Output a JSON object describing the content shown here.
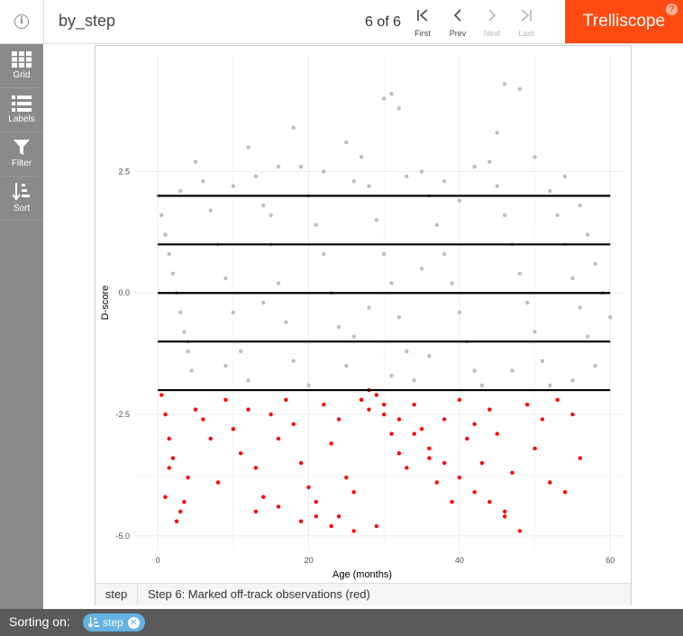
{
  "header": {
    "display_name": "by_step",
    "pager": "6 of 6",
    "nav": [
      {
        "id": "first",
        "glyph": "|<",
        "label": "First",
        "enabled": true
      },
      {
        "id": "prev",
        "glyph": "<",
        "label": "Prev",
        "enabled": true
      },
      {
        "id": "next",
        "glyph": ">",
        "label": "Next",
        "enabled": false
      },
      {
        "id": "last",
        "glyph": ">|",
        "label": "Last",
        "enabled": false
      }
    ],
    "brand": "Trelliscope",
    "help": "?",
    "info": "i"
  },
  "sidebar": {
    "items": [
      {
        "id": "grid",
        "label": "Grid"
      },
      {
        "id": "labels",
        "label": "Labels"
      },
      {
        "id": "filter",
        "label": "Filter"
      },
      {
        "id": "sort",
        "label": "Sort"
      }
    ]
  },
  "panel": {
    "cog_name": "step",
    "cog_value": "Step 6: Marked off-track observations (red)"
  },
  "chart_data": {
    "type": "scatter",
    "xlabel": "Age (months)",
    "ylabel": "D-score",
    "xlim": [
      -3,
      62
    ],
    "ylim": [
      -5.3,
      4.9
    ],
    "xticks": [
      0,
      20,
      40,
      60
    ],
    "yticks": [
      2.5,
      0.0,
      -2.5,
      -5.0
    ],
    "ytick_labels": [
      "2.5",
      "0.0",
      "-2.5",
      "-5.0"
    ],
    "grid": true,
    "reference_lines": [
      2,
      1,
      0,
      -1,
      -2
    ],
    "reference_x_range": [
      0,
      60
    ],
    "colors": {
      "on_track": "#bebebe",
      "off_track": "#ff0000",
      "ref_line": "#000000"
    },
    "series": [
      {
        "name": "",
        "color": "#bebebe",
        "points": [
          [
            0,
            2.0
          ],
          [
            0.5,
            1.6
          ],
          [
            1,
            1.2
          ],
          [
            1.5,
            0.8
          ],
          [
            2,
            0.4
          ],
          [
            2.5,
            0.0
          ],
          [
            3,
            -0.4
          ],
          [
            3.5,
            -0.8
          ],
          [
            4,
            -1.2
          ],
          [
            4.5,
            -1.6
          ],
          [
            6,
            2.3
          ],
          [
            7,
            1.7
          ],
          [
            8,
            1.0
          ],
          [
            9,
            0.3
          ],
          [
            10,
            -0.4
          ],
          [
            11,
            -1.2
          ],
          [
            12,
            -1.8
          ],
          [
            13,
            2.4
          ],
          [
            14,
            1.8
          ],
          [
            15,
            1.0
          ],
          [
            16,
            0.2
          ],
          [
            17,
            -0.6
          ],
          [
            18,
            -1.4
          ],
          [
            19,
            2.6
          ],
          [
            20,
            2.0
          ],
          [
            21,
            1.4
          ],
          [
            22,
            0.8
          ],
          [
            23,
            0.0
          ],
          [
            24,
            -0.7
          ],
          [
            25,
            -1.5
          ],
          [
            27,
            2.8
          ],
          [
            28,
            2.2
          ],
          [
            29,
            1.5
          ],
          [
            30,
            0.8
          ],
          [
            31,
            0.2
          ],
          [
            32,
            -0.5
          ],
          [
            33,
            -1.2
          ],
          [
            34,
            -1.8
          ],
          [
            35,
            2.5
          ],
          [
            36,
            2.0
          ],
          [
            37,
            1.4
          ],
          [
            38,
            0.8
          ],
          [
            39,
            0.2
          ],
          [
            40,
            -0.4
          ],
          [
            41,
            -1.0
          ],
          [
            42,
            -1.6
          ],
          [
            44,
            2.7
          ],
          [
            45,
            2.2
          ],
          [
            46,
            1.6
          ],
          [
            47,
            1.0
          ],
          [
            48,
            0.4
          ],
          [
            49,
            -0.2
          ],
          [
            50,
            -0.8
          ],
          [
            51,
            -1.4
          ],
          [
            52,
            2.1
          ],
          [
            53,
            1.6
          ],
          [
            54,
            1.0
          ],
          [
            55,
            0.3
          ],
          [
            56,
            -0.3
          ],
          [
            57,
            -0.9
          ],
          [
            58,
            -1.5
          ],
          [
            5,
            2.7
          ],
          [
            12,
            3.0
          ],
          [
            18,
            3.4
          ],
          [
            25,
            3.1
          ],
          [
            30,
            4.0
          ],
          [
            31,
            4.1
          ],
          [
            32,
            3.8
          ],
          [
            45,
            3.3
          ],
          [
            46,
            4.3
          ],
          [
            48,
            4.2
          ],
          [
            3,
            2.1
          ],
          [
            10,
            2.2
          ],
          [
            16,
            2.6
          ],
          [
            22,
            2.5
          ],
          [
            26,
            2.3
          ],
          [
            33,
            2.4
          ],
          [
            38,
            2.3
          ],
          [
            42,
            2.6
          ],
          [
            50,
            2.8
          ],
          [
            54,
            2.4
          ],
          [
            4,
            -1.0
          ],
          [
            9,
            -1.5
          ],
          [
            14,
            -0.2
          ],
          [
            20,
            -1.9
          ],
          [
            26,
            -0.9
          ],
          [
            31,
            -1.7
          ],
          [
            36,
            -1.3
          ],
          [
            43,
            -1.9
          ],
          [
            47,
            -1.6
          ],
          [
            55,
            -1.8
          ],
          [
            56,
            1.8
          ],
          [
            57,
            1.2
          ],
          [
            58,
            0.6
          ],
          [
            59,
            0.0
          ],
          [
            60,
            -0.5
          ],
          [
            52,
            -1.9
          ],
          [
            40,
            1.9
          ],
          [
            35,
            0.5
          ],
          [
            28,
            -0.3
          ],
          [
            15,
            1.6
          ]
        ]
      },
      {
        "name": "",
        "color": "#ff0000",
        "points": [
          [
            0.5,
            -2.1
          ],
          [
            1,
            -2.5
          ],
          [
            1.5,
            -3.0
          ],
          [
            2,
            -3.4
          ],
          [
            1,
            -4.2
          ],
          [
            3,
            -4.5
          ],
          [
            2.5,
            -4.7
          ],
          [
            4,
            -3.8
          ],
          [
            5,
            -2.4
          ],
          [
            6,
            -2.6
          ],
          [
            7,
            -3.0
          ],
          [
            8,
            -3.9
          ],
          [
            9,
            -2.2
          ],
          [
            10,
            -2.8
          ],
          [
            11,
            -3.3
          ],
          [
            12,
            -2.4
          ],
          [
            13,
            -3.6
          ],
          [
            14,
            -4.2
          ],
          [
            15,
            -2.5
          ],
          [
            16,
            -3.0
          ],
          [
            17,
            -2.2
          ],
          [
            18,
            -2.7
          ],
          [
            19,
            -3.5
          ],
          [
            20,
            -4.0
          ],
          [
            21,
            -4.6
          ],
          [
            22,
            -2.3
          ],
          [
            23,
            -3.1
          ],
          [
            24,
            -2.6
          ],
          [
            25,
            -3.8
          ],
          [
            26,
            -4.1
          ],
          [
            27,
            -2.2
          ],
          [
            28,
            -2.4
          ],
          [
            29,
            -2.1
          ],
          [
            30,
            -2.5
          ],
          [
            31,
            -2.9
          ],
          [
            32,
            -3.3
          ],
          [
            33,
            -3.6
          ],
          [
            34,
            -2.3
          ],
          [
            35,
            -2.8
          ],
          [
            36,
            -3.4
          ],
          [
            37,
            -3.9
          ],
          [
            38,
            -2.6
          ],
          [
            39,
            -4.3
          ],
          [
            40,
            -2.2
          ],
          [
            41,
            -3.0
          ],
          [
            42,
            -2.7
          ],
          [
            43,
            -3.5
          ],
          [
            44,
            -2.4
          ],
          [
            45,
            -2.9
          ],
          [
            46,
            -4.5
          ],
          [
            47,
            -3.7
          ],
          [
            48,
            -4.9
          ],
          [
            49,
            -2.3
          ],
          [
            50,
            -3.2
          ],
          [
            51,
            -2.6
          ],
          [
            52,
            -3.9
          ],
          [
            53,
            -2.2
          ],
          [
            54,
            -4.1
          ],
          [
            55,
            -2.5
          ],
          [
            56,
            -3.4
          ],
          [
            28,
            -2.0
          ],
          [
            30,
            -2.3
          ],
          [
            32,
            -2.6
          ],
          [
            34,
            -2.9
          ],
          [
            36,
            -3.2
          ],
          [
            38,
            -3.5
          ],
          [
            40,
            -3.8
          ],
          [
            42,
            -4.1
          ],
          [
            44,
            -4.3
          ],
          [
            46,
            -4.6
          ],
          [
            23,
            -4.8
          ],
          [
            26,
            -4.9
          ],
          [
            29,
            -4.8
          ],
          [
            24,
            -4.6
          ],
          [
            3.5,
            -4.3
          ],
          [
            13,
            -4.5
          ],
          [
            16,
            -4.4
          ],
          [
            19,
            -4.7
          ],
          [
            21,
            -4.3
          ],
          [
            1.5,
            -3.6
          ]
        ]
      }
    ]
  },
  "footer": {
    "label": "Sorting on:",
    "sort_chip": "step",
    "sort_icon": "sort-ascending-icon",
    "close_icon": "close-icon"
  }
}
